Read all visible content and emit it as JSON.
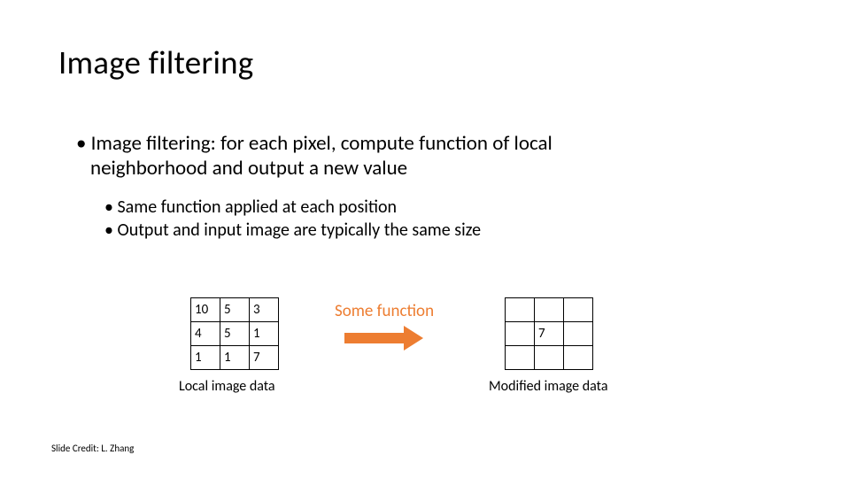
{
  "title": "Image filtering",
  "bullets": {
    "lvl1_line1": "Image filtering: for each pixel, compute function of local",
    "lvl1_line2": "neighborhood and output a new value",
    "lvl2a": "Same function applied at each position",
    "lvl2b": "Output and input image are typically the same size"
  },
  "left_grid": {
    "rows": [
      [
        "10",
        "5",
        "3"
      ],
      [
        "4",
        "5",
        "1"
      ],
      [
        "1",
        "1",
        "7"
      ]
    ],
    "caption": "Local image data"
  },
  "some_function_label": "Some function",
  "right_grid": {
    "rows": [
      [
        "",
        "",
        ""
      ],
      [
        "",
        "7",
        ""
      ],
      [
        "",
        "",
        ""
      ]
    ],
    "caption": "Modified image data"
  },
  "credit": "Slide Credit: L. Zhang",
  "colors": {
    "accent": "#ED7D31"
  }
}
